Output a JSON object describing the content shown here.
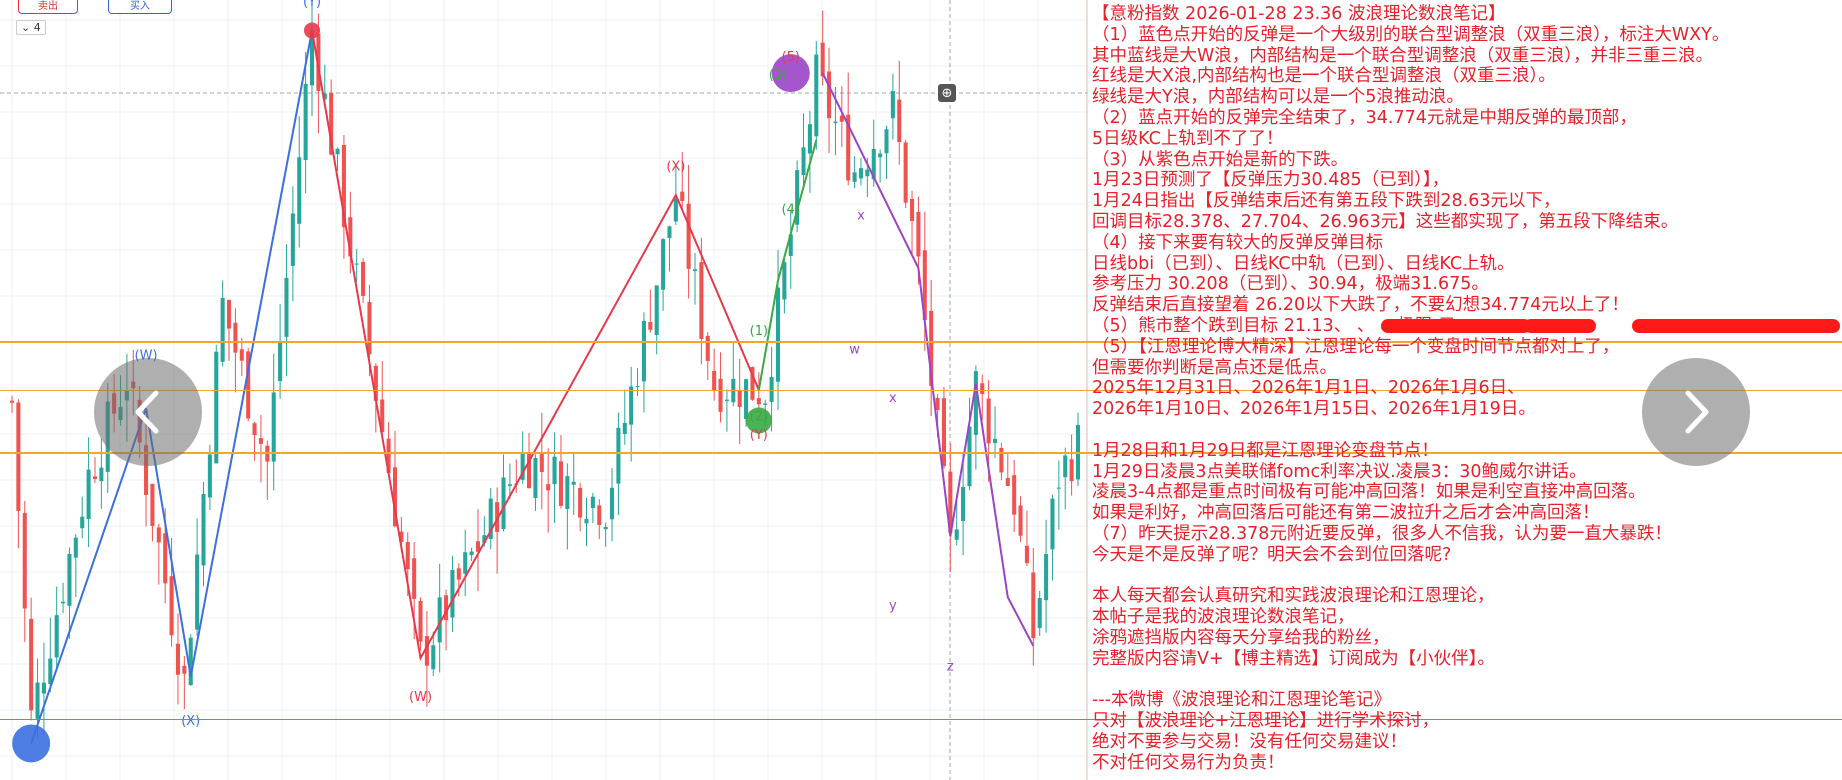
{
  "toolbar": {
    "sell_label": "卖出",
    "buy_label": "买入",
    "interval_label": "⌄ 4"
  },
  "colors": {
    "up": "#26a69a",
    "down": "#ef5350",
    "blue_wave": "#3b6fe0",
    "red_wave": "#e8394a",
    "green_wave": "#3aa844",
    "purple_wave": "#9c44c8",
    "orange_level": "#f5a623",
    "green_level": "#4caf50",
    "text": "#e8202a"
  },
  "chart_data": {
    "type": "candlestick",
    "price_range": [
      23.0,
      35.8
    ],
    "horizontal_levels": [
      {
        "price": 30.2,
        "color": "orange"
      },
      {
        "price": 29.4,
        "color": "orange"
      },
      {
        "price": 28.38,
        "color": "orange"
      },
      {
        "price": 24.0,
        "color": "green"
      }
    ],
    "price_path": [
      {
        "bar": 0,
        "price": 29.2
      },
      {
        "bar": 3,
        "price": 24.0
      },
      {
        "bar": 12,
        "price": 28.0
      },
      {
        "bar": 18,
        "price": 29.6
      },
      {
        "bar": 27,
        "price": 24.6
      },
      {
        "bar": 33,
        "price": 30.8
      },
      {
        "bar": 40,
        "price": 28.2
      },
      {
        "bar": 47,
        "price": 35.3
      },
      {
        "bar": 56,
        "price": 30.0
      },
      {
        "bar": 64,
        "price": 25.0
      },
      {
        "bar": 80,
        "price": 28.3
      },
      {
        "bar": 93,
        "price": 27.5
      },
      {
        "bar": 104,
        "price": 32.6
      },
      {
        "bar": 110,
        "price": 29.5
      },
      {
        "bar": 118,
        "price": 29.4
      },
      {
        "bar": 126,
        "price": 34.5
      },
      {
        "bar": 132,
        "price": 33.0
      },
      {
        "bar": 138,
        "price": 34.0
      },
      {
        "bar": 142,
        "price": 31.4
      },
      {
        "bar": 147,
        "price": 26.8
      },
      {
        "bar": 151,
        "price": 29.5
      },
      {
        "bar": 157,
        "price": 27.6
      },
      {
        "bar": 160,
        "price": 25.4
      },
      {
        "bar": 164,
        "price": 28.0
      },
      {
        "bar": 167,
        "price": 28.5
      }
    ],
    "bar_count": 168,
    "wave_lines": [
      {
        "name": "blue",
        "color": "blue_wave",
        "points": [
          [
            3,
            23.6
          ],
          [
            21,
            29.1
          ],
          [
            28,
            24.7
          ],
          [
            47,
            35.3
          ]
        ]
      },
      {
        "name": "red",
        "color": "red_wave",
        "points": [
          [
            47,
            35.3
          ],
          [
            64,
            25.0
          ],
          [
            104,
            32.6
          ],
          [
            117,
            29.4
          ]
        ]
      },
      {
        "name": "green",
        "color": "green_wave",
        "points": [
          [
            117,
            29.4
          ],
          [
            120,
            31.2
          ],
          [
            126,
            33.5
          ]
        ]
      },
      {
        "name": "purple",
        "color": "purple_wave",
        "points": [
          [
            127,
            34.6
          ],
          [
            142,
            31.4
          ],
          [
            147,
            27.0
          ],
          [
            151,
            29.5
          ],
          [
            156,
            26.0
          ],
          [
            160,
            25.2
          ]
        ]
      }
    ],
    "wave_labels": [
      {
        "text": "(Y)",
        "bar": 47,
        "price": 35.7,
        "color": "blue_wave"
      },
      {
        "text": "(W)",
        "bar": 21,
        "price": 29.9,
        "color": "blue_wave"
      },
      {
        "text": "(X)",
        "bar": 28,
        "price": 23.9,
        "color": "blue_wave"
      },
      {
        "text": "(X)",
        "bar": 104,
        "price": 33.0,
        "color": "red_wave"
      },
      {
        "text": "(W)",
        "bar": 64,
        "price": 24.3,
        "color": "red_wave"
      },
      {
        "text": "(Y)",
        "bar": 117,
        "price": 28.6,
        "color": "red_wave"
      },
      {
        "text": "(5)",
        "bar": 122,
        "price": 34.8,
        "color": "red_wave"
      },
      {
        "text": "(3)",
        "bar": 120,
        "price": 34.5,
        "color": "green_wave"
      },
      {
        "text": "(4)",
        "bar": 122,
        "price": 32.3,
        "color": "green_wave"
      },
      {
        "text": "(1)",
        "bar": 117,
        "price": 30.3,
        "color": "green_wave"
      },
      {
        "text": "(2)",
        "bar": 117,
        "price": 28.9,
        "color": "green_wave"
      },
      {
        "text": "x",
        "bar": 133,
        "price": 32.2,
        "color": "purple_wave"
      },
      {
        "text": "w",
        "bar": 132,
        "price": 30.0,
        "color": "purple_wave"
      },
      {
        "text": "x",
        "bar": 138,
        "price": 29.2,
        "color": "purple_wave"
      },
      {
        "text": "y",
        "bar": 138,
        "price": 25.8,
        "color": "purple_wave"
      },
      {
        "text": "z",
        "bar": 147,
        "price": 24.8,
        "color": "purple_wave"
      }
    ],
    "markers": [
      {
        "bar": 3,
        "price": 23.6,
        "color": "blue_wave",
        "size": "large"
      },
      {
        "bar": 47,
        "price": 35.3,
        "color": "red_wave",
        "size": "small"
      },
      {
        "bar": 117,
        "price": 28.9,
        "color": "green_wave",
        "size": "medium"
      },
      {
        "bar": 122,
        "price": 34.6,
        "color": "purple_wave",
        "size": "large"
      }
    ]
  },
  "notes": [
    "【意粉指数 2026-01-28 23.36 波浪理论数浪笔记】",
    "（1）蓝色点开始的反弹是一个大级别的联合型调整浪（双重三浪），标注大WXY。",
    "其中蓝线是大W浪，内部结构是一个联合型调整浪（双重三浪），并非三重三浪。",
    "红线是大X浪,内部结构也是一个联合型调整浪（双重三浪）。",
    "绿线是大Y浪，内部结构可以是一个5浪推动浪。",
    "（2）蓝点开始的反弹完全结束了，34.774元就是中期反弹的最顶部，",
    "5日级KC上轨到不了了！",
    "（3）从紫色点开始是新的下跌。",
    "1月23日预测了【反弹压力30.485（已到）】，",
    "1月24日指出【反弹结束后还有第五段下跌到28.63元以下，",
    "回调目标28.378、27.704、26.963元】这些都实现了，第五段下降结束。",
    "（4）接下来要有较大的反弹反弹目标",
    "日线bbi（已到）、日线KC中轨（已到）、日线KC上轨。",
    "参考压力 30.208（已到）、30.94，极端31.675。",
    "反弹结束后直接望着 26.20以下大跌了，不要幻想34.774元以上了！",
    "（5）熊市整个跌到目标 21.13、                          、          、极限                            元。",
    "（5）【江恩理论博大精深】江恩理论每一个变盘时间节点都对上了，",
    "但需要你判断是高点还是低点。",
    "2025年12月31日、2026年1月1日、2026年1月6日、",
    "2026年1月10日、2026年1月15日、2026年1月19日。",
    "",
    "1月28日和1月29日都是江恩理论变盘节点！",
    "1月29日凌晨3点美联储fomc利率决议.凌晨3：30鲍威尔讲话。",
    "凌晨3-4点都是重点时间极有可能冲高回落！如果是利空直接冲高回落。",
    "如果是利好，冲高回落后可能还有第二波拉升之后才会冲高回落！",
    "（7）昨天提示28.378元附近要反弹，很多人不信我，认为要一直大暴跌！",
    "今天是不是反弹了呢？明天会不会到位回落呢?",
    "",
    "本人每天都会认真研究和实践波浪理论和江恩理论，",
    "本帖子是我的波浪理论数浪笔记，",
    "涂鸦遮挡版内容每天分享给我的粉丝，",
    "完整版内容请V+【博主精选】订阅成为【小伙伴】。",
    "",
    "---本微博《波浪理论和江恩理论笔记》",
    "只对【波浪理论+江恩理论】进行学术探讨，",
    "绝对不要参与交易！没有任何交易建议！",
    "不对任何交易行为负责！"
  ]
}
